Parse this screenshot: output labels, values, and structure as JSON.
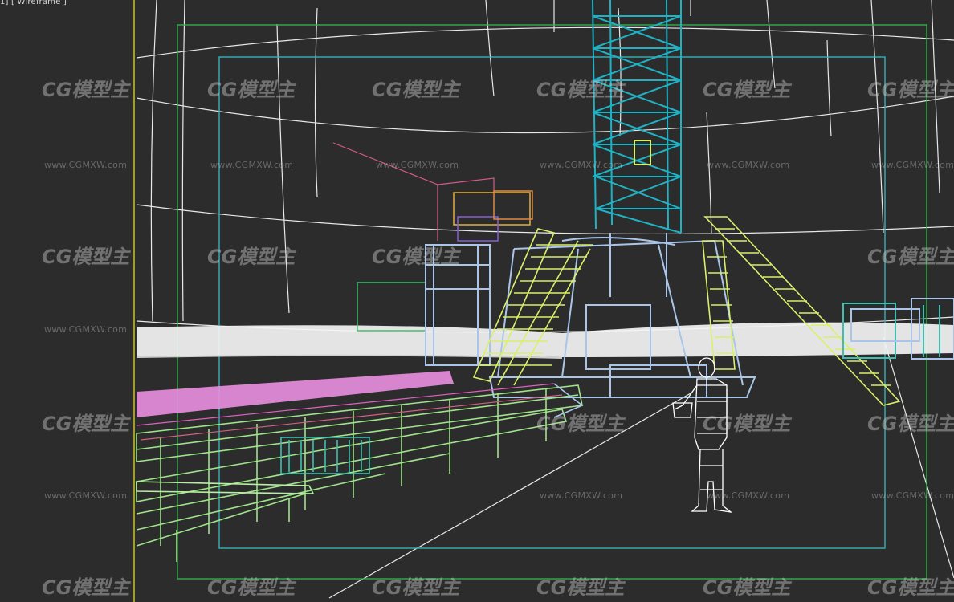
{
  "viewport": {
    "label": "1] [ Wireframe ]"
  },
  "watermark": {
    "logo_text": "CG模型主",
    "url_text": "www.CGMXW.com"
  },
  "colors": {
    "background": "#2c2c2c",
    "grid": "#ececec",
    "safe_frame_outer": "#2fb04a",
    "safe_frame_inner": "#35b3b8",
    "viewport_border": "#c9c22a",
    "derrick": "#1fb2c4",
    "catwalk": "#9fe38a",
    "stairs": "#d9f06a",
    "substructure": "#a9c6ea",
    "pipe_pink": "#e98fe0",
    "figure": "#ffffff"
  }
}
